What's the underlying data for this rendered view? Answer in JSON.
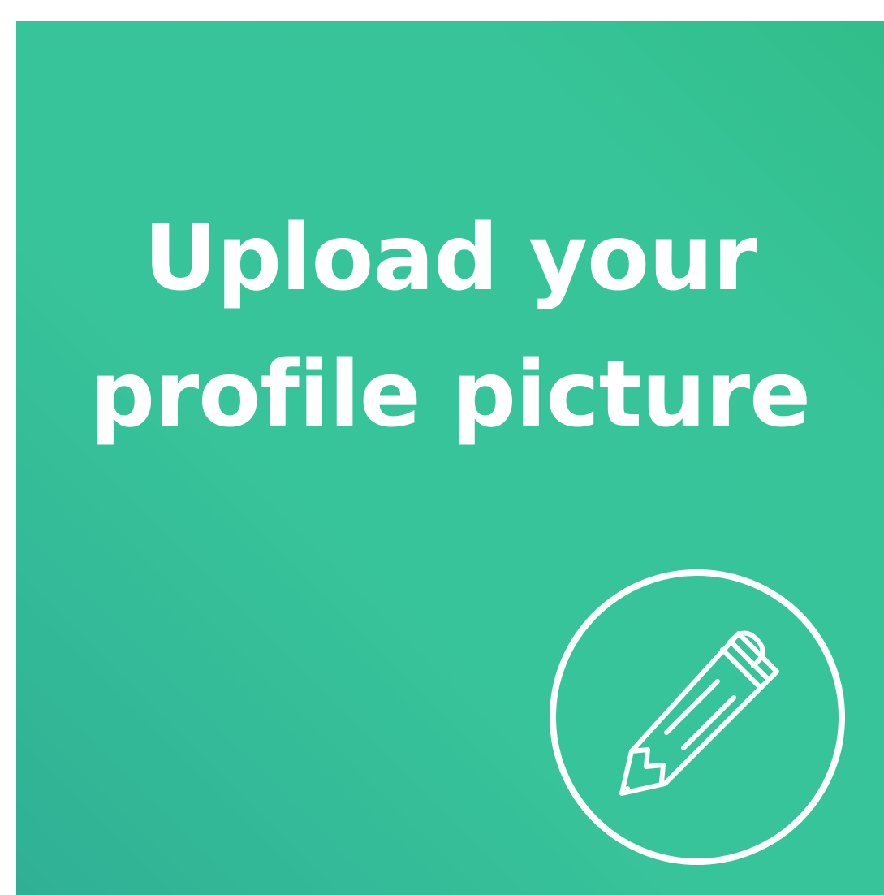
{
  "card": {
    "title_line1": "Upload your",
    "title_line2": "profile picture",
    "accent_color": "#38c49a",
    "text_color": "#ffffff"
  },
  "edit_button": {
    "icon": "pencil-icon"
  }
}
